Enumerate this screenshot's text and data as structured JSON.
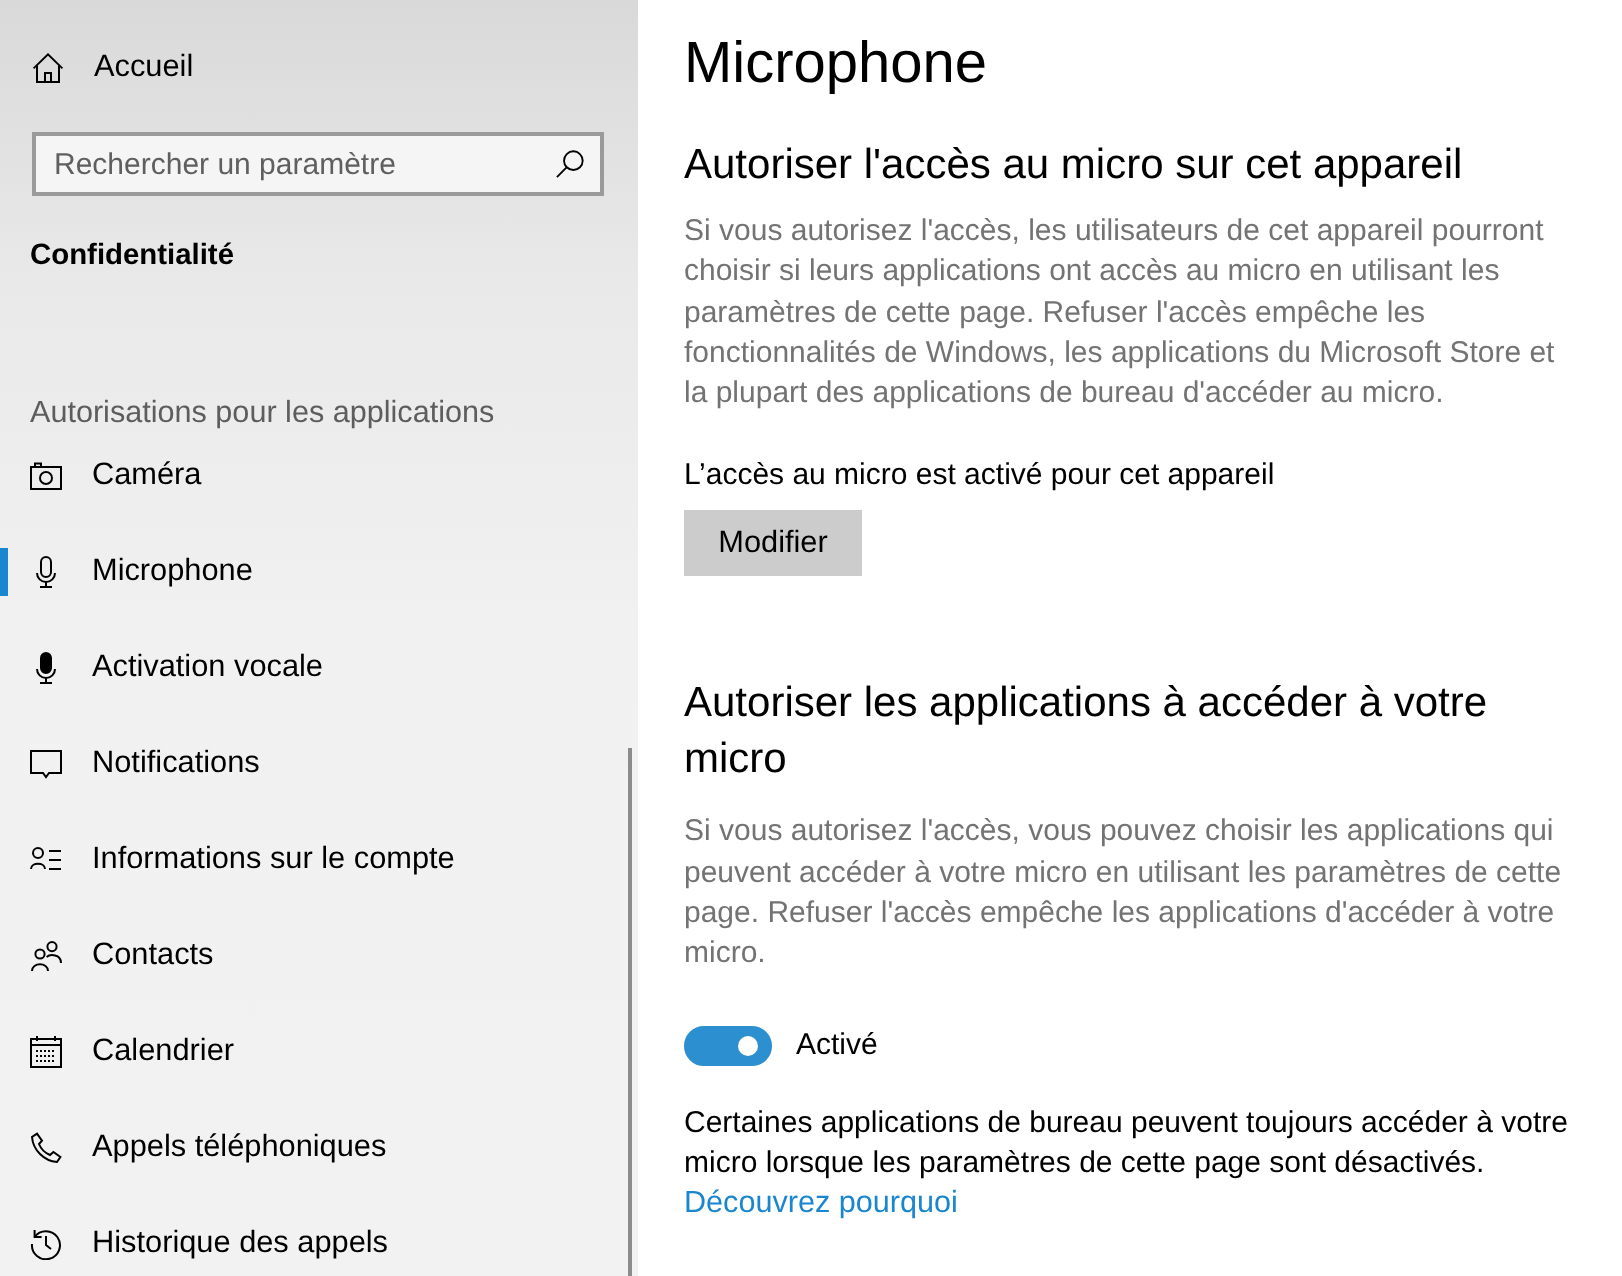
{
  "sidebar": {
    "home": {
      "label": "Accueil"
    },
    "search": {
      "placeholder": "Rechercher un paramètre"
    },
    "section_title": "Confidentialité",
    "group_label": "Autorisations pour les applications",
    "items": [
      {
        "kind": "camera",
        "label": "Caméra",
        "selected": false
      },
      {
        "kind": "microphone",
        "label": "Microphone",
        "selected": true
      },
      {
        "kind": "voice",
        "label": "Activation vocale",
        "selected": false
      },
      {
        "kind": "notifications",
        "label": "Notifications",
        "selected": false
      },
      {
        "kind": "account",
        "label": "Informations sur le compte",
        "selected": false
      },
      {
        "kind": "contacts",
        "label": "Contacts",
        "selected": false
      },
      {
        "kind": "calendar",
        "label": "Calendrier",
        "selected": false
      },
      {
        "kind": "phone",
        "label": "Appels téléphoniques",
        "selected": false
      },
      {
        "kind": "history",
        "label": "Historique des appels",
        "selected": false
      }
    ]
  },
  "page": {
    "title": "Microphone"
  },
  "device_access": {
    "heading": "Autoriser l'accès au micro sur cet appareil",
    "description": "Si vous autorisez l'accès, les utilisateurs de cet appareil pourront choisir si leurs applications ont accès au micro en utilisant les paramètres de cette page. Refuser l'accès empêche les fonctionnalités de Windows, les applications du Microsoft Store et la plupart des applications de bureau d'accéder au micro.",
    "status": "L’accès au micro est activé pour cet appareil",
    "button": "Modifier"
  },
  "app_access": {
    "heading": "Autoriser les applications à accéder à votre micro",
    "description": "Si vous autorisez l'accès, vous pouvez choisir les applications qui peuvent accéder à votre micro en utilisant les paramètres de cette page. Refuser l'accès empêche les applications d'accéder à votre micro.",
    "toggle": {
      "on": true,
      "label": "Activé"
    },
    "note": "Certaines applications de bureau peuvent toujours accéder à votre micro lorsque les paramètres de cette page sont désactivés.",
    "link": "Découvrez pourquoi"
  }
}
